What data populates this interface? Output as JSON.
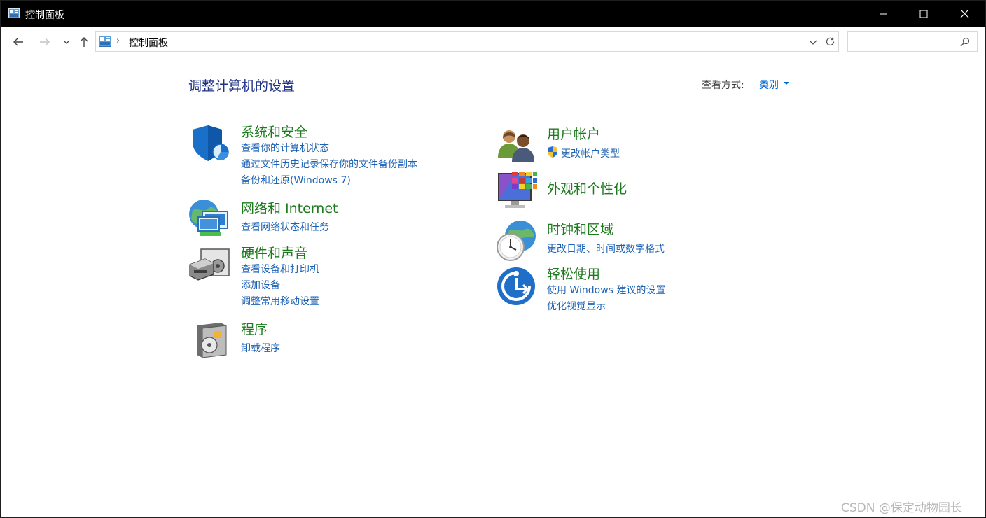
{
  "window": {
    "title": "控制面板"
  },
  "address": {
    "crumb": "控制面板",
    "search_placeholder": ""
  },
  "main": {
    "heading": "调整计算机的设置",
    "view_by_label": "查看方式:",
    "view_by_value": "类别"
  },
  "categories_left": [
    {
      "title": "系统和安全",
      "icon": "security-shield-icon",
      "links": [
        "查看你的计算机状态",
        "通过文件历史记录保存你的文件备份副本",
        "备份和还原(Windows 7)"
      ]
    },
    {
      "title": "网络和 Internet",
      "icon": "network-globe-icon",
      "links": [
        "查看网络状态和任务"
      ]
    },
    {
      "title": "硬件和声音",
      "icon": "printer-speaker-icon",
      "links": [
        "查看设备和打印机",
        "添加设备",
        "调整常用移动设置"
      ]
    },
    {
      "title": "程序",
      "icon": "programs-disc-icon",
      "links": [
        "卸载程序"
      ]
    }
  ],
  "categories_right": [
    {
      "title": "用户帐户",
      "icon": "users-icon",
      "links": [
        "更改帐户类型"
      ]
    },
    {
      "title": "外观和个性化",
      "icon": "monitor-palette-icon",
      "links": []
    },
    {
      "title": "时钟和区域",
      "icon": "clock-globe-icon",
      "links": [
        "更改日期、时间或数字格式"
      ]
    },
    {
      "title": "轻松使用",
      "icon": "ease-of-access-icon",
      "links": [
        "使用 Windows 建议的设置",
        "优化视觉显示"
      ]
    }
  ],
  "watermark": "CSDN @保定动物园长",
  "colors": {
    "category_title": "#1e7a1e",
    "link": "#1c62b4",
    "heading": "#1e3287",
    "titlebar": "#000000"
  }
}
